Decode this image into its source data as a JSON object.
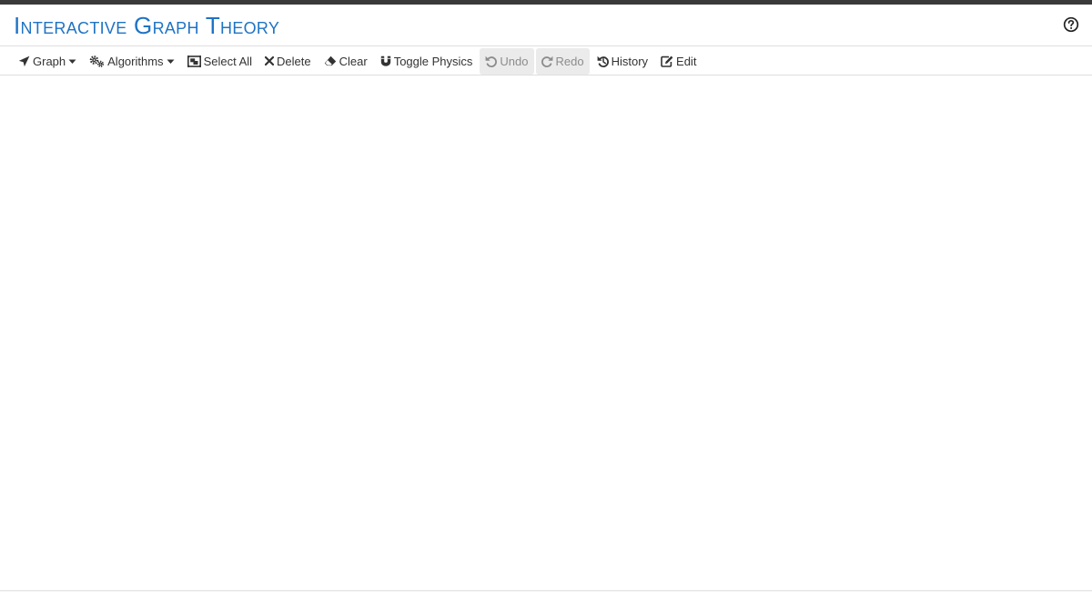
{
  "app": {
    "title": "Interactive Graph Theory"
  },
  "header": {
    "help_icon": "question-circle-icon"
  },
  "toolbar": {
    "items": [
      {
        "label": "Graph",
        "icon": "share-arrow-icon",
        "has_dropdown": true,
        "disabled": false
      },
      {
        "label": "Algorithms",
        "icon": "cogs-icon",
        "has_dropdown": true,
        "disabled": false
      },
      {
        "label": "Select All",
        "icon": "object-group-icon",
        "has_dropdown": false,
        "disabled": false
      },
      {
        "label": "Delete",
        "icon": "times-icon",
        "has_dropdown": false,
        "disabled": false
      },
      {
        "label": "Clear",
        "icon": "eraser-icon",
        "has_dropdown": false,
        "disabled": false
      },
      {
        "label": "Toggle Physics",
        "icon": "magnet-icon",
        "has_dropdown": false,
        "disabled": false
      },
      {
        "label": "Undo",
        "icon": "undo-icon",
        "has_dropdown": false,
        "disabled": true
      },
      {
        "label": "Redo",
        "icon": "redo-icon",
        "has_dropdown": false,
        "disabled": true
      },
      {
        "label": "History",
        "icon": "history-icon",
        "has_dropdown": false,
        "disabled": false
      },
      {
        "label": "Edit",
        "icon": "edit-icon",
        "has_dropdown": false,
        "disabled": false
      }
    ]
  },
  "colors": {
    "title": "#1f73c4",
    "top_stripe": "#3a3a3a",
    "disabled_bg": "#ebebeb",
    "text": "#333333"
  }
}
